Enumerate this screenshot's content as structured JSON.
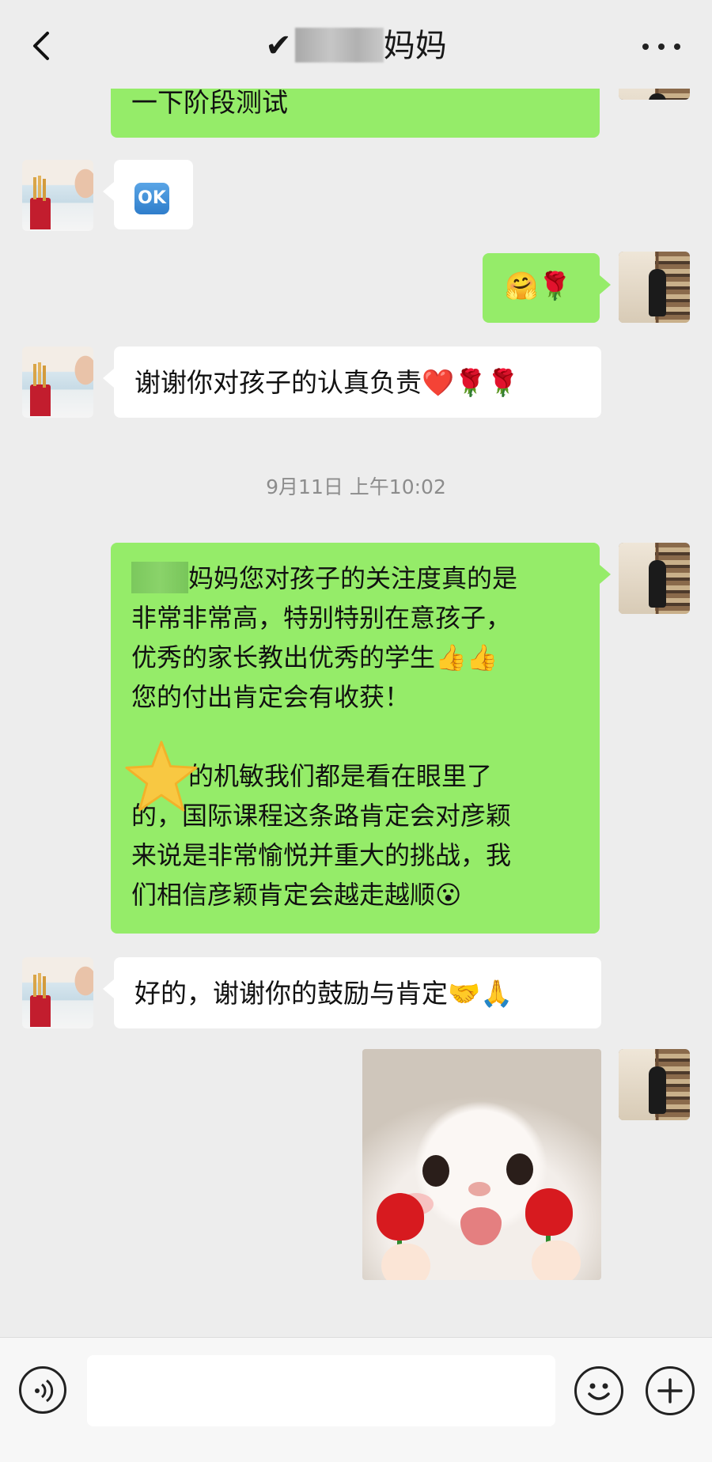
{
  "header": {
    "back_icon": "chevron-left-icon",
    "title_prefix": "✔",
    "title_suffix": "妈妈",
    "more_icon": "more-dots-icon"
  },
  "messages": [
    {
      "side": "out",
      "text": "一下阶段测试"
    },
    {
      "side": "in",
      "emoji": "OK"
    },
    {
      "side": "out",
      "emojis": "🤗🌹"
    },
    {
      "side": "in",
      "text": "谢谢你对孩子的认真负责❤️🌹🌹"
    },
    {
      "side": "out",
      "lines": [
        "妈妈您对孩子的关注度真的是",
        "非常非常高，特别特别在意孩子，",
        "优秀的家长教出优秀的学生👍👍",
        "您的付出肯定会有收获！",
        "",
        "的机敏我们都是看在眼里了",
        "的，国际课程这条路肯定会对彦颖",
        "来说是非常愉悦并重大的挑战，我",
        "们相信彦颖肯定会越走越顺😮"
      ]
    },
    {
      "side": "in",
      "text": "好的，谢谢你的鼓励与肯定🤝🙏"
    },
    {
      "side": "out",
      "sticker": "cat-with-roses-sticker"
    }
  ],
  "timestamp": "9月11日 上午10:02",
  "input": {
    "voice_icon": "voice-icon",
    "emoji_icon": "emoji-icon",
    "plus_icon": "plus-icon",
    "value": ""
  }
}
